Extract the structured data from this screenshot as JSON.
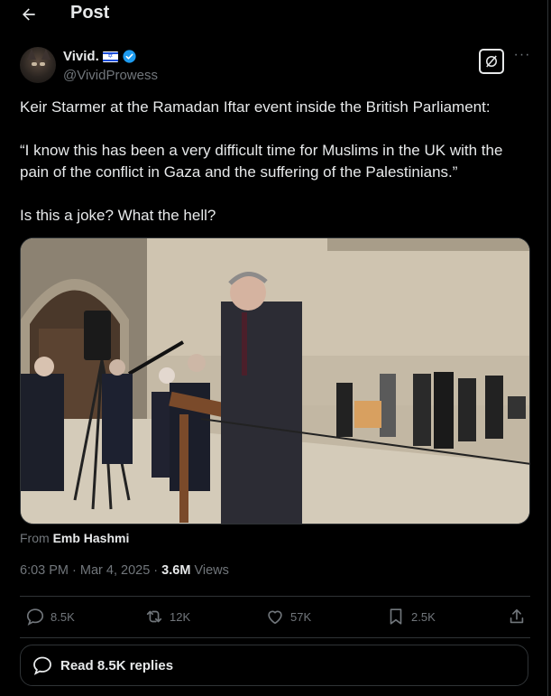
{
  "header": {
    "title": "Post"
  },
  "author": {
    "display_name": "Vivid.",
    "handle": "@VividProwess"
  },
  "tweet": {
    "line1": "Keir Starmer at the Ramadan Iftar event inside the British Parliament:",
    "line2": "“I know this has been a very difficult time for Muslims in the UK with the pain of the conflict in Gaza and the suffering of the Palestinians.”",
    "line3": "Is this a joke? What the hell?"
  },
  "media": {
    "source_prefix": "From",
    "source_name": "Emb Hashmi"
  },
  "meta": {
    "time": "6:03 PM",
    "date": "Mar 4, 2025",
    "views_count": "3.6M",
    "views_label": "Views"
  },
  "actions": {
    "replies": "8.5K",
    "reposts": "12K",
    "likes": "57K",
    "bookmarks": "2.5K"
  },
  "read_replies": {
    "label": "Read 8.5K replies"
  },
  "colors": {
    "background": "#000000",
    "text": "#e7e9ea",
    "secondary": "#71767b",
    "verified": "#1d9bf0",
    "border": "#2f3336"
  }
}
